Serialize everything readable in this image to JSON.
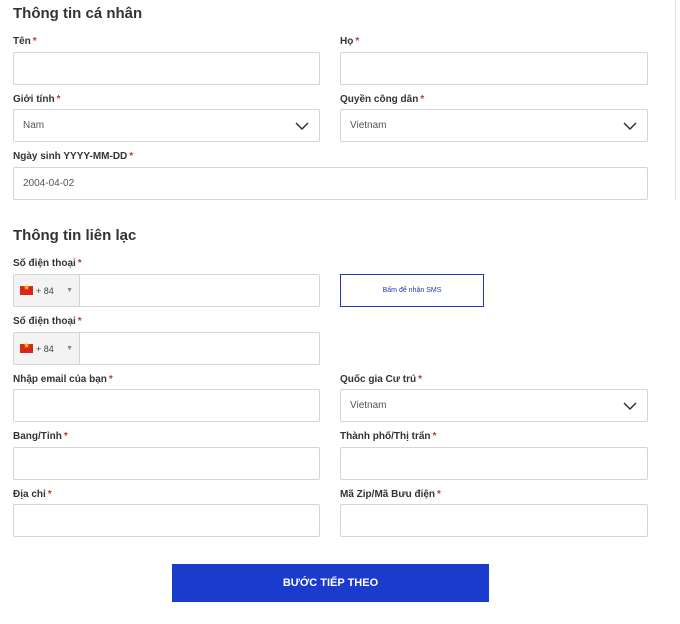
{
  "personal": {
    "heading": "Thông tin cá nhân",
    "first_name": {
      "label": "Tên",
      "value": ""
    },
    "last_name": {
      "label": "Họ",
      "value": ""
    },
    "gender": {
      "label": "Giới tính",
      "value": "Nam"
    },
    "citizenship": {
      "label": "Quyền công dân",
      "value": "Vietnam"
    },
    "dob": {
      "label": "Ngày sinh YYYY-MM-DD",
      "value": "2004-04-02"
    }
  },
  "contact": {
    "heading": "Thông tin liên lạc",
    "phone1": {
      "label": "Số điện thoại",
      "code": "+ 84",
      "value": ""
    },
    "sms_button": "Bấm để nhận SMS",
    "phone2": {
      "label": "Số điện thoại",
      "code": "+ 84",
      "value": ""
    },
    "email": {
      "label": "Nhập email của bạn",
      "value": ""
    },
    "residence": {
      "label": "Quốc gia Cư trú",
      "value": "Vietnam"
    },
    "state": {
      "label": "Bang/Tỉnh",
      "value": ""
    },
    "city": {
      "label": "Thành phố/Thị trấn",
      "value": ""
    },
    "address": {
      "label": "Địa chỉ",
      "value": ""
    },
    "zip": {
      "label": "Mã Zip/Mã Bưu điện",
      "value": ""
    }
  },
  "required_mark": "*",
  "next_button": "BƯỚC TIẾP THEO"
}
